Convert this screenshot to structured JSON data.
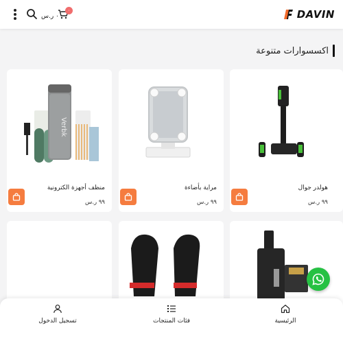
{
  "header": {
    "logo_text": "DAVIN",
    "cart_badge": "٠",
    "cart_price": "٠ ر.س"
  },
  "section": {
    "title": "اكسسوارات متنوعة"
  },
  "products": [
    {
      "name": "منظف أجهزة الكترونية",
      "price": "٩٩ ر.س",
      "image_label": "Verbk"
    },
    {
      "name": "مراية بأضاءة",
      "price": "٩٩ ر.س"
    },
    {
      "name": "هولدر جوال",
      "price": "٩٩ ر.س"
    },
    {
      "name": "",
      "price": ""
    },
    {
      "name": "",
      "price": ""
    },
    {
      "name": "",
      "price": ""
    }
  ],
  "bottom_nav": {
    "login": "تسجيل الدخول",
    "categories": "فئات المنتجات",
    "home": "الرئيسية"
  },
  "colors": {
    "accent_orange": "#f57c3f",
    "brand_orange": "#f26a2a",
    "whatsapp_green": "#26c143",
    "badge_red": "#f06d6d"
  },
  "icons": [
    "menu-dots-icon",
    "search-icon",
    "cart-icon",
    "bag-icon",
    "whatsapp-icon",
    "user-icon",
    "list-icon",
    "home-icon"
  ]
}
